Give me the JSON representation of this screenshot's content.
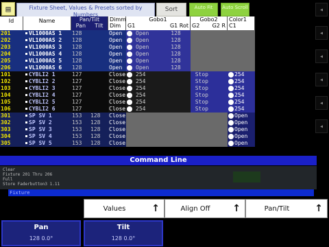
{
  "header": {
    "title": "Fixture Sheet, Values & Presets sorted by Numbers",
    "sort_label": "Sort",
    "green_buttons": [
      "Auto Fit",
      "Auto Scroll"
    ],
    "columns": [
      "Id",
      "Name",
      "Pan/Tilt",
      "Dimm",
      "Gobo1",
      "Gobo2",
      "Color1"
    ],
    "sub_columns": {
      "pan_tilt": [
        "Pan",
        "Tilt"
      ],
      "dimm": [
        "Dim"
      ],
      "gobo1": [
        "G1",
        "G1 Rot"
      ],
      "gobo2": [
        "G2",
        "G2 R"
      ],
      "color1": [
        "C1"
      ]
    }
  },
  "rows": [
    {
      "id": "201",
      "name": "VL1000AS 1",
      "pan": "128",
      "tilt": "",
      "dim": "Open",
      "g1": "Open",
      "g1rot": "128",
      "g2": "",
      "g2r": "",
      "c1": "",
      "style": "vl"
    },
    {
      "id": "202",
      "name": "VL1000AS 2",
      "pan": "128",
      "tilt": "",
      "dim": "Open",
      "g1": "Open",
      "g1rot": "128",
      "g2": "",
      "g2r": "",
      "c1": "",
      "style": "vl"
    },
    {
      "id": "203",
      "name": "VL1000AS 3",
      "pan": "128",
      "tilt": "",
      "dim": "Open",
      "g1": "Open",
      "g1rot": "128",
      "g2": "",
      "g2r": "",
      "c1": "",
      "style": "vl"
    },
    {
      "id": "204",
      "name": "VL1000AS 4",
      "pan": "128",
      "tilt": "",
      "dim": "Open",
      "g1": "Open",
      "g1rot": "128",
      "g2": "",
      "g2r": "",
      "c1": "",
      "style": "vl"
    },
    {
      "id": "205",
      "name": "VL1000AS 5",
      "pan": "128",
      "tilt": "",
      "dim": "Open",
      "g1": "Open",
      "g1rot": "128",
      "g2": "",
      "g2r": "",
      "c1": "",
      "style": "vl"
    },
    {
      "id": "206",
      "name": "VL1000AS 6",
      "pan": "128",
      "tilt": "",
      "dim": "Open",
      "g1": "Open",
      "g1rot": "128",
      "g2": "",
      "g2r": "",
      "c1": "",
      "style": "vl"
    },
    {
      "id": "101",
      "name": "CYBLI2 1",
      "pan": "127",
      "tilt": "",
      "dim": "Close",
      "g1": "254",
      "g1rot": "",
      "g2": "Stop",
      "g2r": "",
      "c1": "254",
      "style": "cy"
    },
    {
      "id": "102",
      "name": "CYBLI2 2",
      "pan": "127",
      "tilt": "",
      "dim": "Close",
      "g1": "254",
      "g1rot": "",
      "g2": "Stop",
      "g2r": "",
      "c1": "254",
      "style": "cy"
    },
    {
      "id": "103",
      "name": "CYBLI2 3",
      "pan": "127",
      "tilt": "",
      "dim": "Close",
      "g1": "254",
      "g1rot": "",
      "g2": "Stop",
      "g2r": "",
      "c1": "254",
      "style": "cy"
    },
    {
      "id": "104",
      "name": "CYBLI2 4",
      "pan": "127",
      "tilt": "",
      "dim": "Close",
      "g1": "254",
      "g1rot": "",
      "g2": "Stop",
      "g2r": "",
      "c1": "254",
      "style": "cy"
    },
    {
      "id": "105",
      "name": "CYBLI2 5",
      "pan": "127",
      "tilt": "",
      "dim": "Close",
      "g1": "254",
      "g1rot": "",
      "g2": "Stop",
      "g2r": "",
      "c1": "254",
      "style": "cy"
    },
    {
      "id": "106",
      "name": "CYBLI2 6",
      "pan": "127",
      "tilt": "",
      "dim": "Close",
      "g1": "254",
      "g1rot": "",
      "g2": "Stop",
      "g2r": "",
      "c1": "254",
      "style": "cy"
    },
    {
      "id": "301",
      "name": "SP SV 1",
      "pan": "153",
      "tilt": "128",
      "dim": "Close",
      "g1": "",
      "g1rot": "",
      "g2": "",
      "g2r": "",
      "c1": "Open",
      "style": "sp"
    },
    {
      "id": "302",
      "name": "SP SV 2",
      "pan": "153",
      "tilt": "128",
      "dim": "Close",
      "g1": "",
      "g1rot": "",
      "g2": "",
      "g2r": "",
      "c1": "Open",
      "style": "sp"
    },
    {
      "id": "303",
      "name": "SP SV 3",
      "pan": "153",
      "tilt": "128",
      "dim": "Close",
      "g1": "",
      "g1rot": "",
      "g2": "",
      "g2r": "",
      "c1": "Open",
      "style": "sp"
    },
    {
      "id": "304",
      "name": "SP SV 4",
      "pan": "153",
      "tilt": "128",
      "dim": "Close",
      "g1": "",
      "g1rot": "",
      "g2": "",
      "g2r": "",
      "c1": "Open",
      "style": "sp"
    },
    {
      "id": "305",
      "name": "SP SV 5",
      "pan": "153",
      "tilt": "128",
      "dim": "Close",
      "g1": "",
      "g1rot": "",
      "g2": "",
      "g2r": "",
      "c1": "Open",
      "style": "sp"
    }
  ],
  "command": {
    "title": "Command Line",
    "history": [
      "Clear",
      "Fixture 201 Thru 206",
      "Full",
      "Store Faderbutton3 1.11"
    ],
    "input": "Fixture"
  },
  "bottom": {
    "buttons": [
      {
        "label": "Values",
        "arrow": "↑"
      },
      {
        "label": "Align Off",
        "arrow": "↑"
      },
      {
        "label": "Pan/Tilt",
        "arrow": "↑"
      }
    ],
    "encoders": [
      {
        "label": "Pan",
        "value": "128 0.0°"
      },
      {
        "label": "Tilt",
        "value": "128 0.0°"
      }
    ]
  },
  "side": {
    "arrow": "◂"
  },
  "colors": {
    "vl_row": "#182f7f",
    "cy_row": "#0b0b0b",
    "sp_row": "#15205a",
    "accent": "#1a20c8",
    "id_yellow": "#f2e600"
  }
}
